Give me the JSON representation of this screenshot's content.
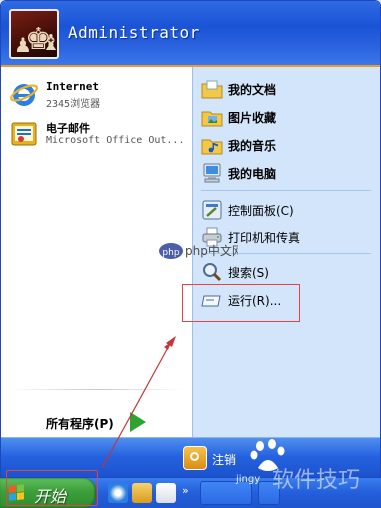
{
  "user": {
    "name": "Administrator"
  },
  "pinned": [
    {
      "title": "Internet",
      "subtitle": "2345浏览器",
      "icon": "ie-icon"
    },
    {
      "title": "电子邮件",
      "subtitle": "Microsoft Office Out...",
      "icon": "email-icon"
    }
  ],
  "all_programs": {
    "label": "所有程序(P)"
  },
  "right_items": [
    {
      "label": "我的文档",
      "icon": "my-documents-icon",
      "bold": true
    },
    {
      "label": "图片收藏",
      "icon": "my-pictures-icon",
      "bold": true
    },
    {
      "label": "我的音乐",
      "icon": "my-music-icon",
      "bold": true
    },
    {
      "label": "我的电脑",
      "icon": "my-computer-icon",
      "bold": true
    },
    {
      "label": "控制面板(C)",
      "icon": "control-panel-icon",
      "bold": false
    },
    {
      "label": "打印机和传真",
      "icon": "printer-icon",
      "bold": false
    },
    {
      "label": "搜索(S)",
      "icon": "search-icon",
      "bold": false
    },
    {
      "label": "运行(R)...",
      "icon": "run-icon",
      "bold": false
    }
  ],
  "footer": {
    "logoff_label": "注销"
  },
  "taskbar": {
    "start_label": "开始",
    "more": "»"
  },
  "watermarks": {
    "php": "php中文网",
    "baidu_sub": "jingy",
    "site": "软件技巧"
  },
  "colors": {
    "header_blue": "#1a54d6",
    "right_pane": "#d3e5fa",
    "start_green": "#3c9f3a",
    "annotation_red": "#e0454a"
  }
}
